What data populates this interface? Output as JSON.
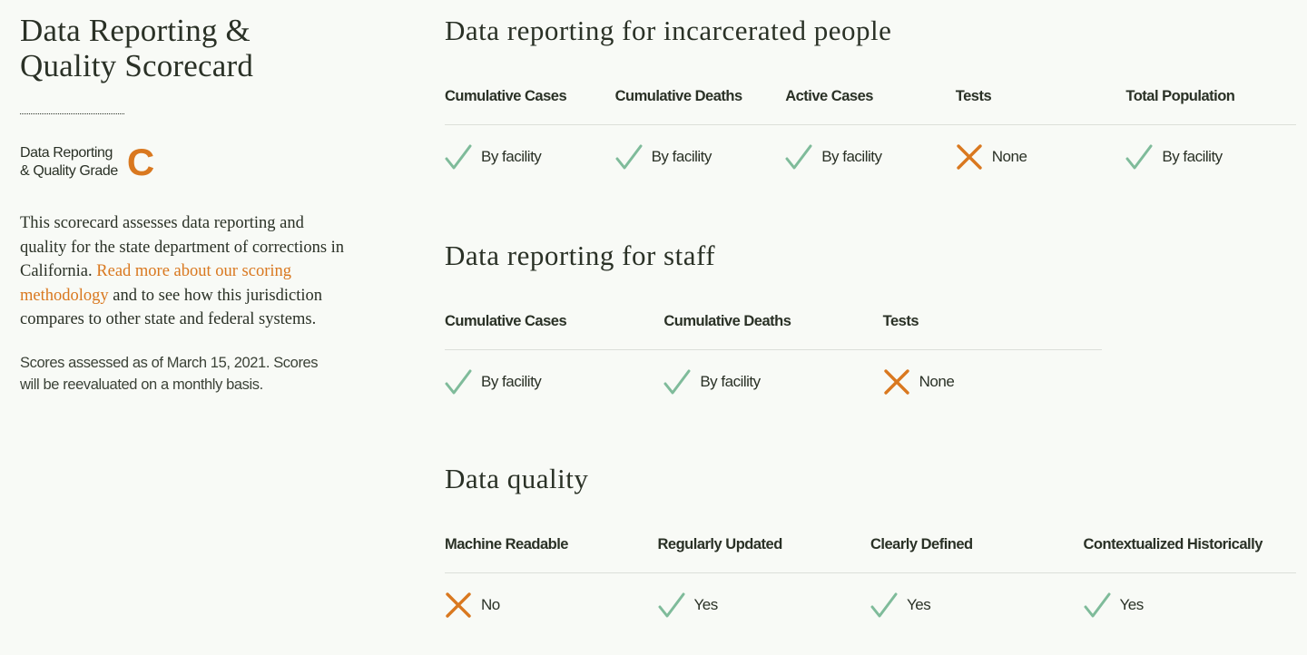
{
  "sidebar": {
    "title_line1": "Data Reporting &",
    "title_line2": "Quality Scorecard",
    "grade_label_line1": "Data Reporting",
    "grade_label_line2": "& Quality Grade",
    "grade": "C",
    "description_pre": "This scorecard assesses data reporting and quality for the state department of corrections in California. ",
    "description_link": "Read more about our scoring methodology",
    "description_post": " and to see how this jurisdiction compares to other state and federal systems.",
    "assessed_note": "Scores assessed as of March 15, 2021. Scores will be reevaluated on a monthly basis."
  },
  "colors": {
    "accent": "#d9781f",
    "check": "#7fbb9a",
    "text": "#2a3126",
    "background": "#f8faf6"
  },
  "sections": [
    {
      "title": "Data reporting for incarcerated people",
      "metrics": [
        {
          "label": "Cumulative Cases",
          "status": "check-icon",
          "value": "By facility"
        },
        {
          "label": "Cumulative Deaths",
          "status": "check-icon",
          "value": "By facility"
        },
        {
          "label": "Active Cases",
          "status": "check-icon",
          "value": "By facility"
        },
        {
          "label": "Tests",
          "status": "x-icon",
          "value": "None"
        },
        {
          "label": "Total Population",
          "status": "check-icon",
          "value": "By facility"
        }
      ]
    },
    {
      "title": "Data reporting for staff",
      "metrics": [
        {
          "label": "Cumulative Cases",
          "status": "check-icon",
          "value": "By facility"
        },
        {
          "label": "Cumulative Deaths",
          "status": "check-icon",
          "value": "By facility"
        },
        {
          "label": "Tests",
          "status": "x-icon",
          "value": "None"
        }
      ]
    },
    {
      "title": "Data quality",
      "metrics": [
        {
          "label": "Machine Readable",
          "status": "x-icon",
          "value": "No"
        },
        {
          "label": "Regularly Updated",
          "status": "check-icon",
          "value": "Yes"
        },
        {
          "label": "Clearly Defined",
          "status": "check-icon",
          "value": "Yes"
        },
        {
          "label": "Contextualized Historically",
          "status": "check-icon",
          "value": "Yes"
        }
      ]
    }
  ]
}
